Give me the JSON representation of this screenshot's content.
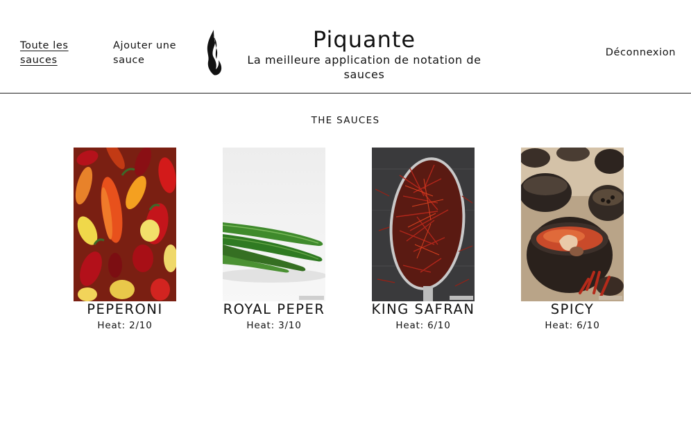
{
  "nav": {
    "all_sauces": "Toute les sauces",
    "add_sauce": "Ajouter une sauce",
    "logout": "Déconnexion"
  },
  "brand": {
    "title": "Piquante",
    "tagline": "La meilleure application de notation de sauces",
    "logo_icon": "flame-icon"
  },
  "section": {
    "title": "THE SAUCES"
  },
  "sauces": [
    {
      "name": "PEPERONI",
      "heat": "Heat: 2/10",
      "image": "mixed-chili-peppers-photo"
    },
    {
      "name": "ROYAL PEPER",
      "heat": "Heat: 3/10",
      "image": "green-peppers-photo"
    },
    {
      "name": "KING SAFRAN",
      "heat": "Heat: 6/10",
      "image": "saffron-spoon-photo"
    },
    {
      "name": "SPICY",
      "heat": "Heat: 6/10",
      "image": "spice-bowls-photo"
    }
  ],
  "colors": {
    "text": "#111111",
    "background": "#ffffff",
    "divider": "#222222"
  }
}
